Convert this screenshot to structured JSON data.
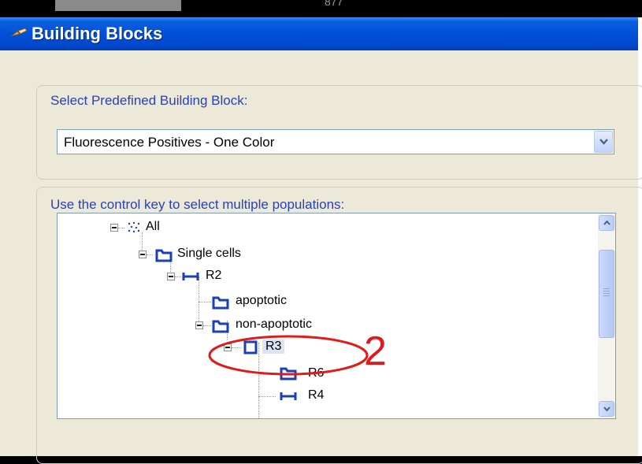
{
  "top_strip": {
    "number": "877"
  },
  "window": {
    "title": "Building Blocks",
    "icon": "tool-icon"
  },
  "predefined": {
    "legend": "Select Predefined Building Block:",
    "selected": "Fluorescence Positives - One Color"
  },
  "populations": {
    "legend": "Use the control key to select multiple populations:",
    "nodes": [
      {
        "label": "All",
        "icon": "dots-icon"
      },
      {
        "label": "Single cells",
        "icon": "gate-icon"
      },
      {
        "label": "R2",
        "icon": "range-icon"
      },
      {
        "label": "apoptotic",
        "icon": "gate-icon"
      },
      {
        "label": "non-apoptotic",
        "icon": "gate-icon"
      },
      {
        "label": "R3",
        "icon": "rectangle-icon",
        "selected": true
      },
      {
        "label": "R6",
        "icon": "gate-icon"
      },
      {
        "label": "R4",
        "icon": "range-icon"
      }
    ]
  },
  "annotation": {
    "label": "2",
    "color": "#e01b1b"
  },
  "colors": {
    "title_bar": "#0050d8",
    "group_label": "#2b41b4",
    "tree_icon": "#1a3fb8"
  }
}
